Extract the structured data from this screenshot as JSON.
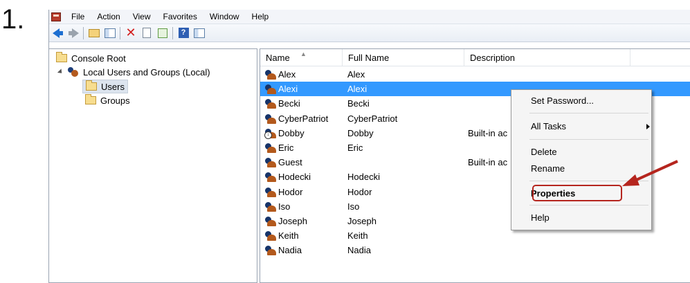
{
  "step": "1.",
  "menubar": {
    "items": [
      "File",
      "Action",
      "View",
      "Favorites",
      "Window",
      "Help"
    ]
  },
  "toolbar": {
    "icons": [
      "back-arrow-icon",
      "forward-arrow-icon",
      "up-folder-icon",
      "show-hide-pane-icon",
      "delete-icon",
      "properties-icon",
      "export-list-icon",
      "help-icon",
      "show-hide-action-pane-icon"
    ]
  },
  "tree": {
    "root": "Console Root",
    "local_users": "Local Users and Groups (Local)",
    "users": "Users",
    "groups": "Groups"
  },
  "list": {
    "columns": [
      "Name",
      "Full Name",
      "Description"
    ],
    "rows": [
      {
        "name": "Alex",
        "full": "Alex",
        "desc": ""
      },
      {
        "name": "Alexi",
        "full": "Alexi",
        "desc": ""
      },
      {
        "name": "Becki",
        "full": "Becki",
        "desc": ""
      },
      {
        "name": "CyberPatriot",
        "full": "CyberPatriot",
        "desc": ""
      },
      {
        "name": "Dobby",
        "full": "Dobby",
        "desc": "Built-in ac"
      },
      {
        "name": "Eric",
        "full": "Eric",
        "desc": ""
      },
      {
        "name": "Guest",
        "full": "",
        "desc": "Built-in ac"
      },
      {
        "name": "Hodecki",
        "full": "Hodecki",
        "desc": ""
      },
      {
        "name": "Hodor",
        "full": "Hodor",
        "desc": ""
      },
      {
        "name": "Iso",
        "full": "Iso",
        "desc": ""
      },
      {
        "name": "Joseph",
        "full": "Joseph",
        "desc": ""
      },
      {
        "name": "Keith",
        "full": "Keith",
        "desc": ""
      },
      {
        "name": "Nadia",
        "full": "Nadia",
        "desc": ""
      }
    ],
    "selected_row": "Alexi"
  },
  "context_menu": {
    "set_password": "Set Password...",
    "all_tasks": "All Tasks",
    "delete": "Delete",
    "rename": "Rename",
    "properties": "Properties",
    "help": "Help"
  },
  "colors": {
    "selection": "#3399ff",
    "annotation": "#b5251e"
  }
}
